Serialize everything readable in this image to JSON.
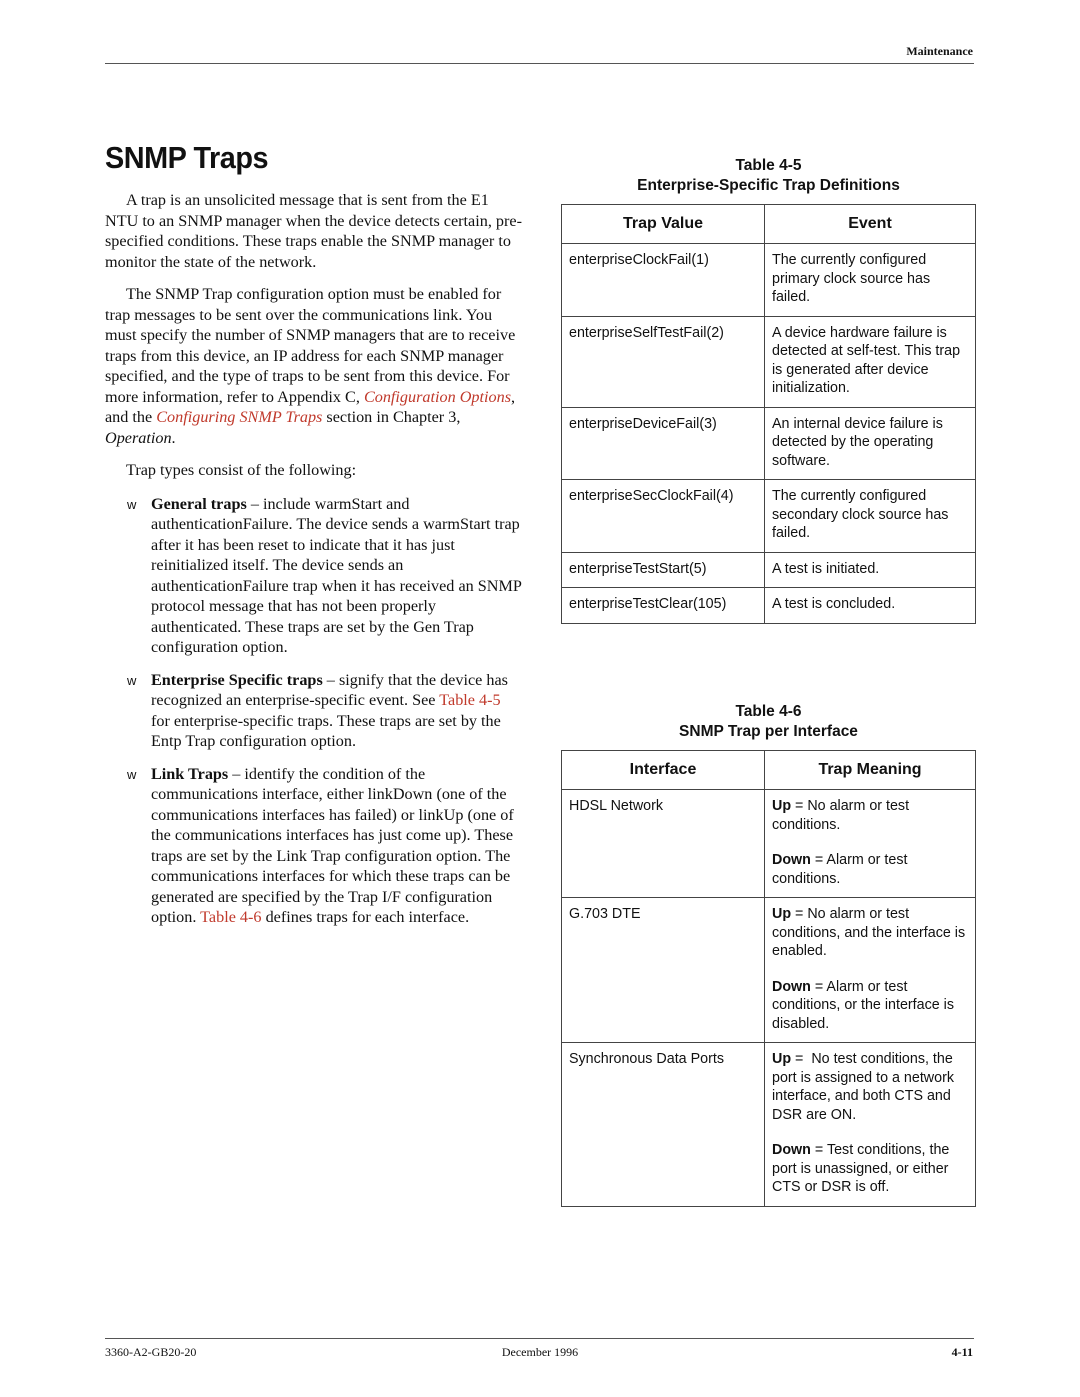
{
  "header": {
    "running_head": "Maintenance"
  },
  "section": {
    "title": "SNMP Traps",
    "para1": "A trap is an unsolicited message that is sent from the E1 NTU to an SNMP manager when the device detects certain, pre-specified conditions. These traps enable the SNMP manager to monitor the state of the network.",
    "para2": {
      "text1": "The SNMP Trap configuration option must be enabled for trap messages to be sent over the communications link. You must specify the number of SNMP managers that are to receive traps from this device, an IP address for each SNMP manager specified, and the type of traps to be sent from this device. For more information, refer to Appendix C, ",
      "link1": "Configuration Options",
      "text2": ", and the ",
      "link2": "Configuring SNMP Traps",
      "text3": " section in Chapter 3, ",
      "italic": "Operation",
      "text4": "."
    },
    "para3": "Trap types consist of the following:",
    "bullet_mark": "w",
    "bullets": [
      {
        "term": "General traps",
        "text": " – include warmStart and authenticationFailure. The device sends a warmStart trap after it has been reset to indicate that it has just reinitialized itself. The device sends an authenticationFailure trap when it has received an SNMP protocol message that has not been properly authenticated. These traps are set by the Gen Trap configuration option."
      },
      {
        "term": "Enterprise Specific traps",
        "text": " – signify that the device has recognized an enterprise-specific event. See ",
        "link": "Table 4-5",
        "text2": " for enterprise-specific traps. These traps are set by the Entp Trap configuration option."
      },
      {
        "term": "Link Traps",
        "text": " – identify the condition of the communications interface, either linkDown (one of the communications interfaces has failed) or linkUp (one of the communications interfaces has just come up). These traps are set by the Link Trap configuration option. The communications interfaces for which these traps can be generated are specified by the Trap I/F configuration option. ",
        "link": "Table 4-6",
        "text2": " defines traps for each interface."
      }
    ]
  },
  "table45": {
    "number": "Table 4-5",
    "title": "Enterprise-Specific Trap Definitions",
    "headers": [
      "Trap Value",
      "Event"
    ],
    "rows": [
      [
        "enterpriseClockFail(1)",
        "The currently configured primary clock source has failed."
      ],
      [
        "enterpriseSelfTestFail(2)",
        "A device hardware failure is detected at self-test. This trap is generated after device initialization."
      ],
      [
        "enterpriseDeviceFail(3)",
        "An internal device failure is detected by the operating software."
      ],
      [
        "enterpriseSecClockFail(4)",
        "The currently configured secondary clock source has failed."
      ],
      [
        "enterpriseTestStart(5)",
        "A test is initiated."
      ],
      [
        "enterpriseTestClear(105)",
        "A test is concluded."
      ]
    ]
  },
  "table46": {
    "number": "Table 4-6",
    "title": "SNMP Trap per Interface",
    "headers": [
      "Interface",
      "Trap Meaning"
    ],
    "rows": [
      {
        "interface": "HDSL Network",
        "up_label": "Up",
        "up_text": " = No alarm or test conditions.",
        "down_label": "Down",
        "down_text": " = Alarm or test conditions."
      },
      {
        "interface": "G.703 DTE",
        "up_label": "Up",
        "up_text": " = No alarm or test conditions, and the interface is enabled.",
        "down_label": "Down",
        "down_text": " = Alarm or test conditions, or the interface is disabled."
      },
      {
        "interface": "Synchronous Data Ports",
        "up_label": "Up",
        "up_text": " =  No test conditions, the port is assigned to a network interface, and both CTS and DSR are ON.",
        "down_label": "Down",
        "down_text": " = Test conditions, the port is unassigned, or either CTS or DSR is off."
      }
    ]
  },
  "footer": {
    "doc_number": "3360-A2-GB20-20",
    "date": "December 1996",
    "page": "4-11"
  },
  "colors": {
    "link": "#c0392b",
    "text": "#111111",
    "rule": "#555555"
  }
}
